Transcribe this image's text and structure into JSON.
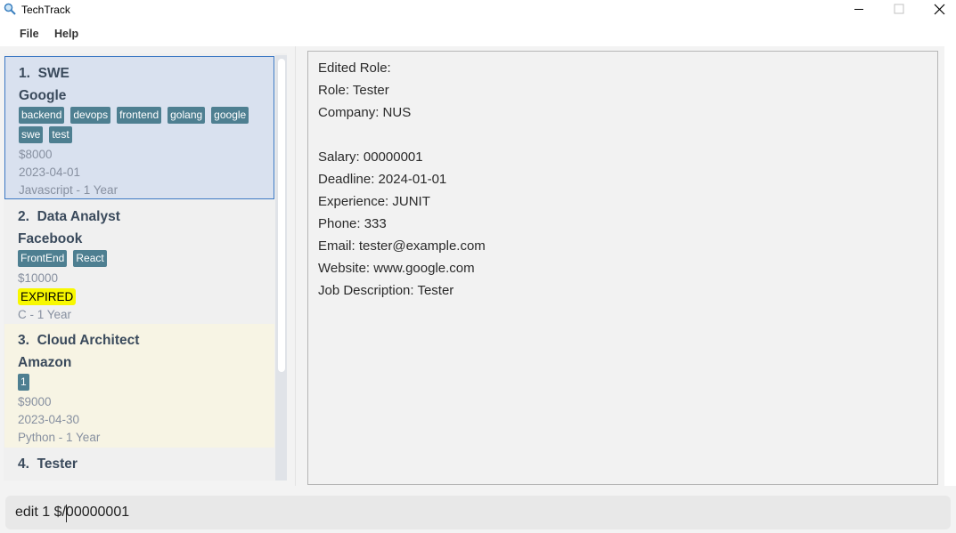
{
  "window": {
    "title": "TechTrack",
    "app_icon": "magnifier-icon",
    "controls": [
      "minimize-icon",
      "maximize-icon",
      "close-icon"
    ]
  },
  "menu": {
    "file": "File",
    "help": "Help"
  },
  "roles": [
    {
      "index": "1.",
      "title": "SWE",
      "company": "Google",
      "tags": [
        "backend",
        "devops",
        "frontend",
        "golang",
        "google",
        "swe",
        "test"
      ],
      "salary": "$8000",
      "deadline": "2023-04-01",
      "experience": "Javascript - 1 Year",
      "expired": ""
    },
    {
      "index": "2.",
      "title": "Data Analyst",
      "company": "Facebook",
      "tags": [
        "FrontEnd",
        "React"
      ],
      "salary": "$10000",
      "deadline": "",
      "expired": "EXPIRED",
      "experience": "C - 1 Year"
    },
    {
      "index": "3.",
      "title": "Cloud Architect",
      "company": "Amazon",
      "tags": [
        "1"
      ],
      "salary": "$9000",
      "deadline": "2023-04-30",
      "experience": "Python - 1 Year",
      "expired": ""
    },
    {
      "index": "4.",
      "title": "Tester"
    }
  ],
  "detail": {
    "heading": "Edited Role:",
    "role": "Role: Tester",
    "company": "Company: NUS",
    "salary": "Salary: 00000001",
    "deadline": "Deadline: 2024-01-01",
    "experience": "Experience: JUNIT",
    "phone": "Phone: 333",
    "email": "Email: tester@example.com",
    "website": "Website: www.google.com",
    "job_description": "Job Description: Tester"
  },
  "command": {
    "value": "edit 1 $/00000001"
  },
  "colors": {
    "tag_bg": "#4e7f91",
    "selected_bg": "#d9e1ef",
    "selected_border": "#3d79c4",
    "alt_card_bg": "#f7f4e4",
    "expired_bg": "#f8f800"
  }
}
